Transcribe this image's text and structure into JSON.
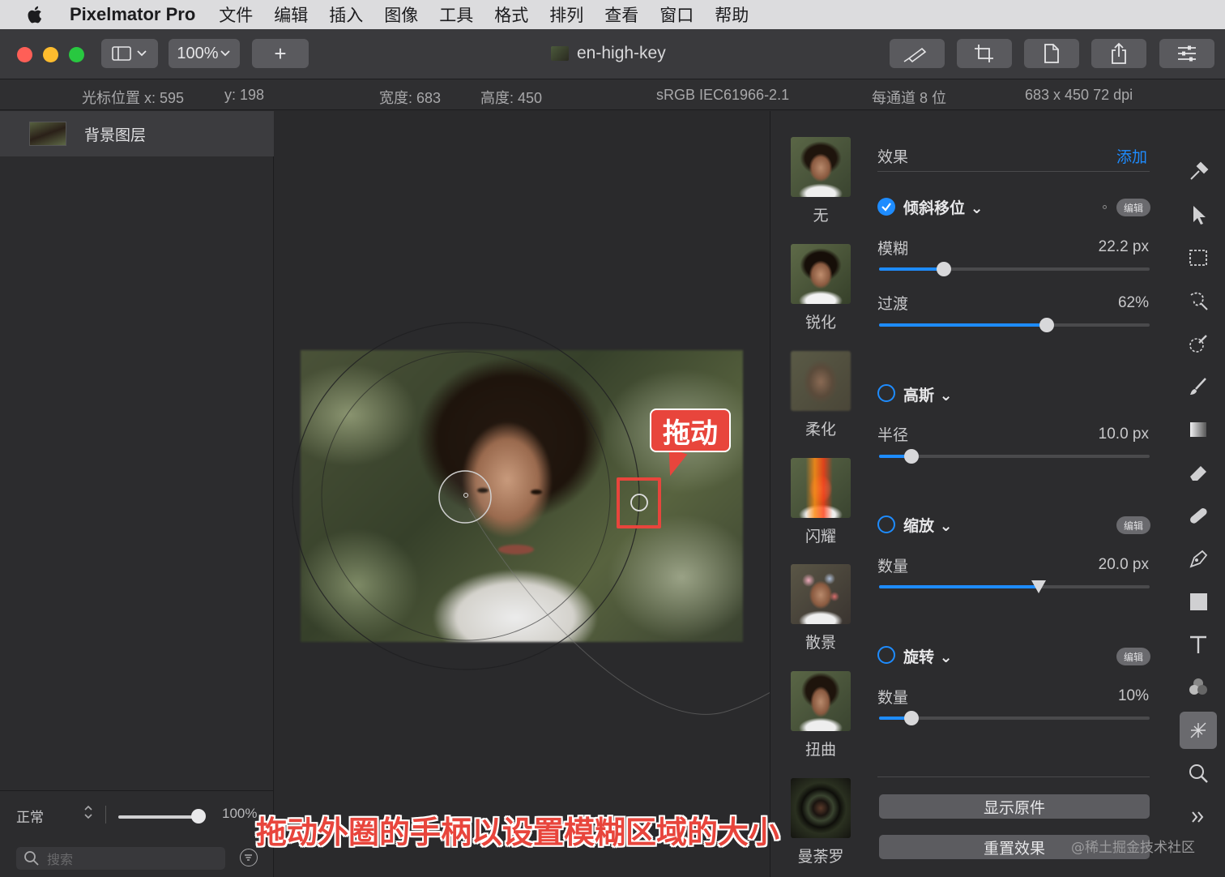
{
  "menubar": {
    "app_name": "Pixelmator Pro",
    "items": [
      "文件",
      "编辑",
      "插入",
      "图像",
      "工具",
      "格式",
      "排列",
      "查看",
      "窗口",
      "帮助"
    ]
  },
  "toolbar": {
    "zoom": "100%",
    "add": "+",
    "document_title": "en-high-key"
  },
  "infobar": {
    "cursor_x_label": "光标位置 x: 595",
    "cursor_y_label": "y: 198",
    "width_label": "宽度: 683",
    "height_label": "高度: 450",
    "color_profile": "sRGB IEC61966-2.1",
    "bit_depth": "每通道 8 位",
    "dimensions": "683 x 450 72 dpi"
  },
  "layers": {
    "layer_name": "背景图层",
    "blend_mode": "正常",
    "opacity": "100%",
    "search_placeholder": "搜索"
  },
  "canvas": {
    "callout": "拖动"
  },
  "effects_thumbs": [
    "无",
    "锐化",
    "柔化",
    "闪耀",
    "散景",
    "扭曲",
    "曼荼罗"
  ],
  "effects_panel": {
    "header": "效果",
    "add": "添加",
    "edit_label": "编辑",
    "tilt_shift": {
      "name": "倾斜移位 ⌄",
      "enabled": true,
      "blur_label": "模糊",
      "blur_value": "22.2 px",
      "blur_fraction": 0.24,
      "transition_label": "过渡",
      "transition_value": "62%",
      "transition_fraction": 0.62
    },
    "gaussian": {
      "name": "高斯 ⌄",
      "enabled": false,
      "radius_label": "半径",
      "radius_value": "10.0 px",
      "radius_fraction": 0.12
    },
    "zoom": {
      "name": "缩放 ⌄",
      "enabled": false,
      "amount_label": "数量",
      "amount_value": "20.0 px",
      "amount_fraction": 0.59
    },
    "spin": {
      "name": "旋转 ⌄",
      "enabled": false,
      "amount_label": "数量",
      "amount_value": "10%",
      "amount_fraction": 0.12
    },
    "show_original": "显示原件",
    "reset_effects": "重置效果"
  },
  "overlay": {
    "subtitle": "拖动外圈的手柄以设置模糊区域的大小",
    "watermark": "@稀土掘金技术社区"
  },
  "colors": {
    "accent": "#1e8cff",
    "annotation_red": "#e8453c",
    "close": "#ff5f57",
    "minimize": "#febc2e",
    "zoom_light": "#28c840"
  }
}
